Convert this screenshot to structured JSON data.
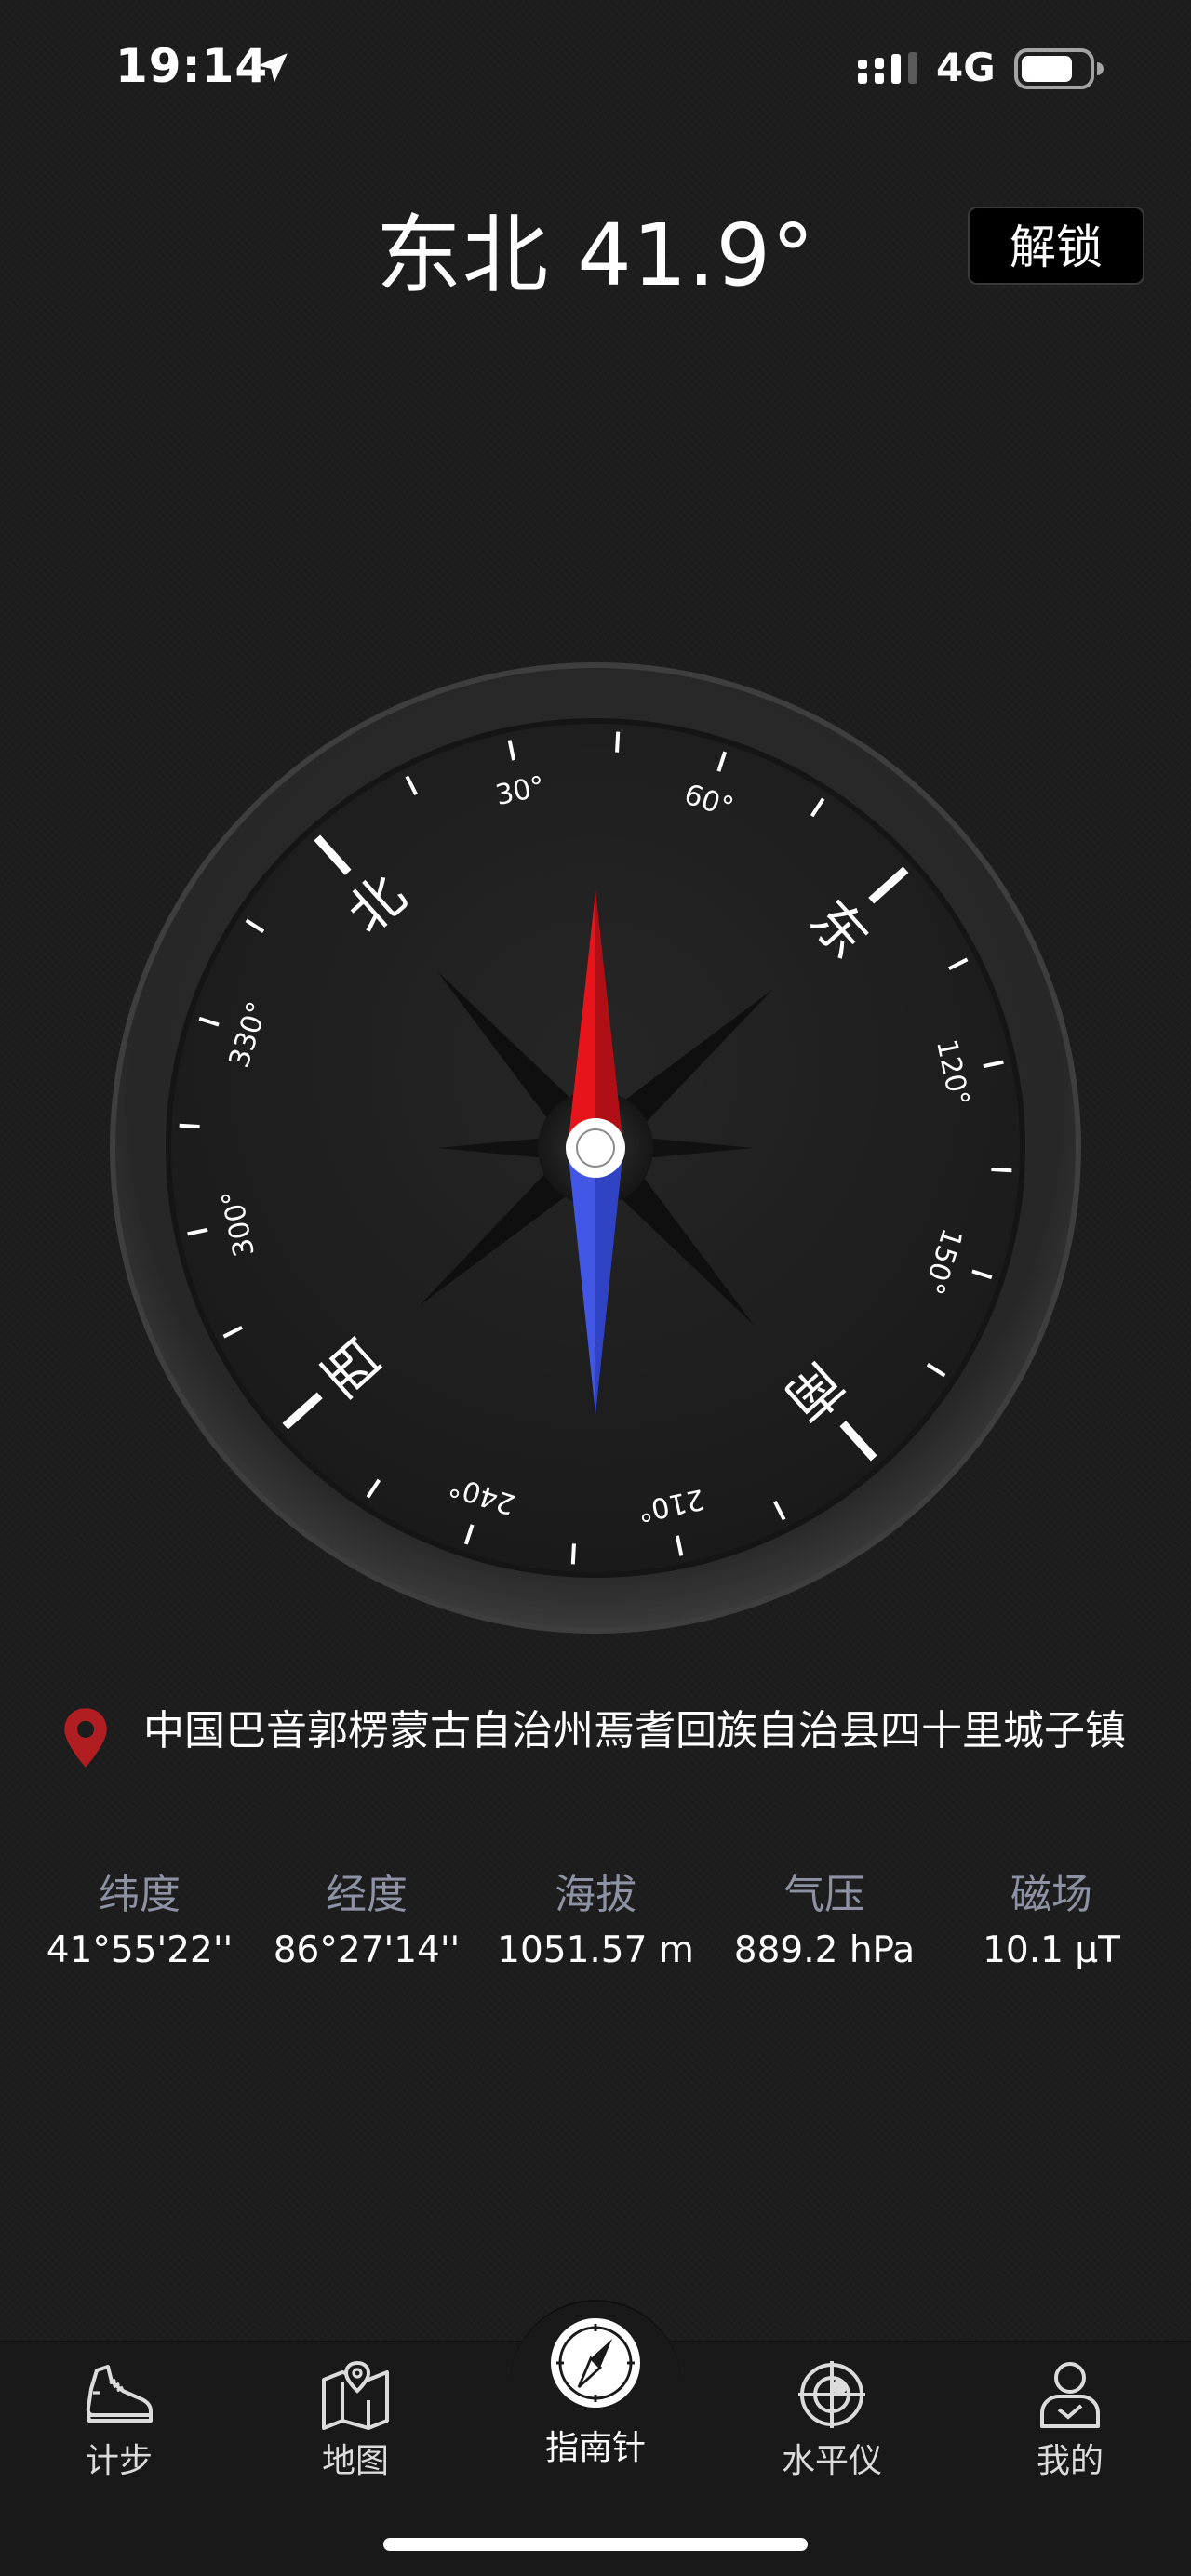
{
  "status_bar": {
    "time": "19:14",
    "network": "4G",
    "battery_percent": 70
  },
  "header": {
    "heading": "东北 41.9°",
    "unlock_label": "解锁"
  },
  "compass": {
    "heading_degrees": 41.9,
    "cardinals": [
      "北",
      "东",
      "南",
      "西"
    ],
    "degree_labels": [
      "30°",
      "60°",
      "120°",
      "150°",
      "210°",
      "240°",
      "300°",
      "330°"
    ],
    "north_color": "#e8141c",
    "south_color": "#3e56e0"
  },
  "location": {
    "address": "中国巴音郭楞蒙古自治州焉耆回族自治县四十里城子镇"
  },
  "stats": [
    {
      "label": "纬度",
      "value": "41°55'22''"
    },
    {
      "label": "经度",
      "value": "86°27'14''"
    },
    {
      "label": "海拔",
      "value": "1051.57 m"
    },
    {
      "label": "气压",
      "value": "889.2 hPa"
    },
    {
      "label": "磁场",
      "value": "10.1 µT"
    }
  ],
  "tabbar": {
    "items": [
      {
        "label": "计步",
        "icon": "shoe-icon"
      },
      {
        "label": "地图",
        "icon": "map-icon"
      },
      {
        "label": "指南针",
        "icon": "compass-icon",
        "active": true
      },
      {
        "label": "水平仪",
        "icon": "level-icon"
      },
      {
        "label": "我的",
        "icon": "profile-icon"
      }
    ]
  }
}
